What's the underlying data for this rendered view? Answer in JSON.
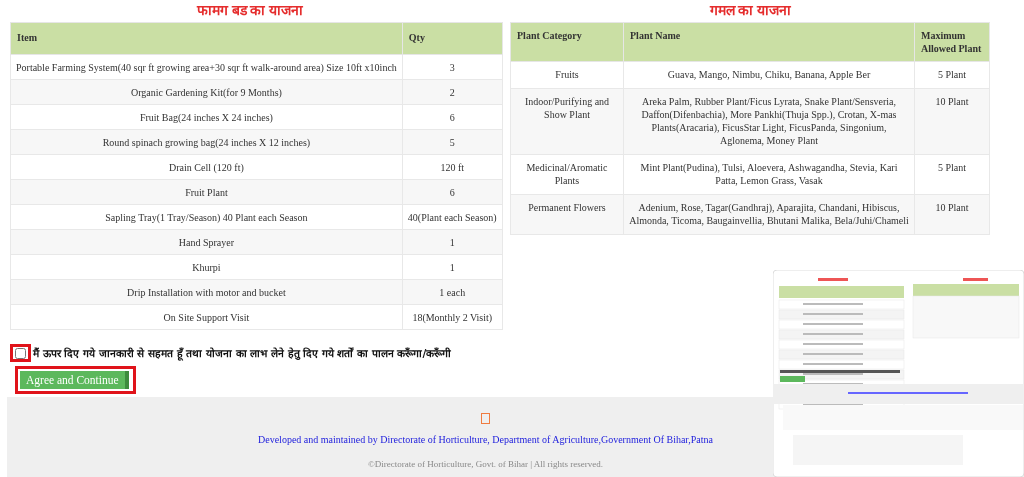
{
  "left_table": {
    "title": "फामग बड का याजना",
    "columns": [
      "Item",
      "Qty"
    ],
    "rows": [
      [
        "Portable Farming System(40 sqr ft growing area+30 sqr ft walk-around area) Size 10ft x10inch",
        "3"
      ],
      [
        "Organic Gardening Kit(for 9 Months)",
        "2"
      ],
      [
        "Fruit Bag(24 inches X 24 inches)",
        "6"
      ],
      [
        "Round spinach growing bag(24 inches X 12 inches)",
        "5"
      ],
      [
        "Drain Cell (120 ft)",
        "120 ft"
      ],
      [
        "Fruit Plant",
        "6"
      ],
      [
        "Sapling Tray(1 Tray/Season) 40 Plant each Season",
        "40(Plant each Season)"
      ],
      [
        "Hand Sprayer",
        "1"
      ],
      [
        "Khurpi",
        "1"
      ],
      [
        "Drip Installation with motor and bucket",
        "1 each"
      ],
      [
        "On Site Support Visit",
        "18(Monthly 2 Visit)"
      ]
    ]
  },
  "right_table": {
    "title": "गमल का याजना",
    "columns": [
      "Plant Category",
      "Plant Name",
      "Maximum Allowed Plant"
    ],
    "rows": [
      [
        "Fruits",
        "Guava, Mango, Nimbu, Chiku, Banana, Apple Ber",
        "5 Plant"
      ],
      [
        "Indoor/Purifying and Show Plant",
        "Areka Palm, Rubber Plant/Ficus Lyrata, Snake Plant/Sensveria, Daffon(Difenbachia), More Pankhi(Thuja Spp.), Crotan, X-mas Plants(Aracaria), FicusStar Light, FicusPanda, Singonium, Aglonema, Money Plant",
        "10 Plant"
      ],
      [
        "Medicinal/Aromatic Plants",
        "Mint Plant(Pudina), Tulsi, Aloevera, Ashwagandha, Stevia, Kari Patta, Lemon Grass, Vasak",
        "5 Plant"
      ],
      [
        "Permanent Flowers",
        "Adenium, Rose, Tagar(Gandhraj), Aparajita, Chandani, Hibiscus, Almonda, Ticoma, Baugainvellia, Bhutani Malika, Bela/Juhi/Chameli",
        "10 Plant"
      ]
    ]
  },
  "consent": {
    "checked": false,
    "text": "मैं ऊपर दिए गये जानकारी से सहमत हूँ तथा योजना का लाभ लेने हेतु दिए गये शर्तों का पालन करूँगा/करूँगी"
  },
  "agree_button": "Agree and Continue",
  "footer": {
    "credit": "Developed and maintained by Directorate of Horticulture, Department of Agriculture,Government Of Bihar,Patna",
    "copyright": "©Directorate of Horticulture, Govt. of Bihar | All rights reserved."
  }
}
